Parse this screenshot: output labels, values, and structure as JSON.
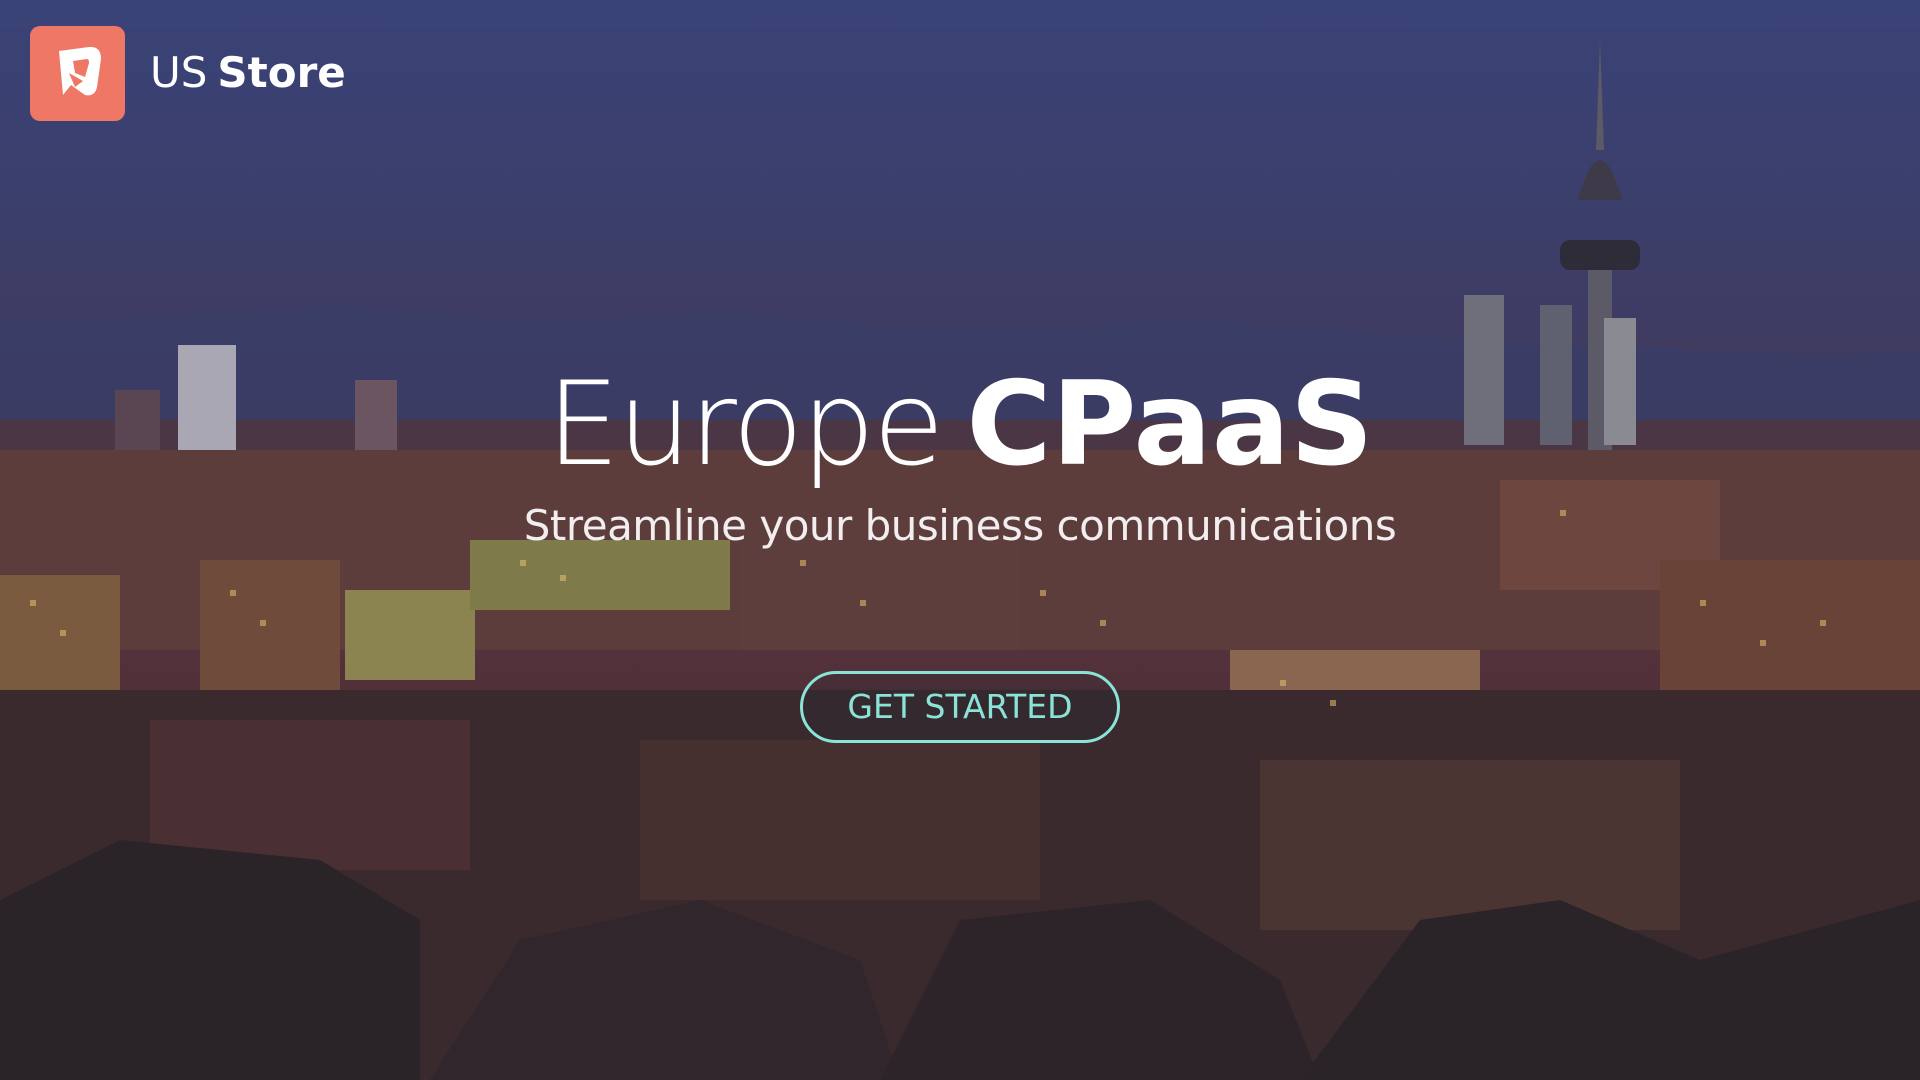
{
  "header": {
    "logo_icon": "store-logo-icon",
    "brand_light": "US",
    "brand_bold": "Store",
    "logo_color": "#ee7765"
  },
  "hero": {
    "headline_light": "Europe",
    "headline_bold": "CPaaS",
    "subheadline": "Streamline your business communications",
    "cta_label": "GET STARTED",
    "cta_color": "#8be3d8",
    "background": "night-city-skyline-photo"
  }
}
